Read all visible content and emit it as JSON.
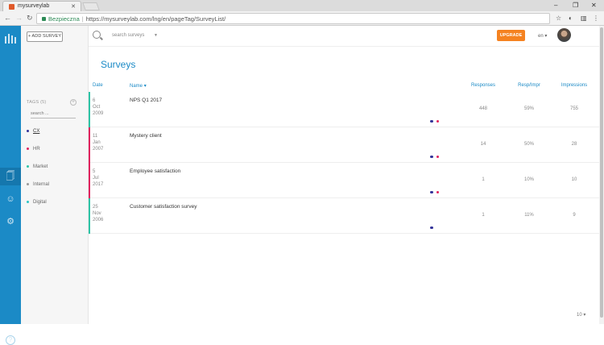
{
  "browser": {
    "tab_title": "mysurveylab",
    "secure_label": "Bezpieczna",
    "url": "https://mysurveylab.com/lng/en/pageTag/SurveyList/"
  },
  "app": {
    "add_survey_label": "+ ADD SURVEY",
    "search_placeholder": "search surveys",
    "upgrade_label": "UPGRADE",
    "language": "en",
    "page_title": "Surveys",
    "tags": {
      "heading": "TAGS (5)",
      "search_placeholder": "search ...",
      "items": [
        {
          "label": "CX",
          "color": "#333399"
        },
        {
          "label": "HR",
          "color": "#e0245e"
        },
        {
          "label": "Market",
          "color": "#2ec4a6"
        },
        {
          "label": "Internal",
          "color": "#999999"
        },
        {
          "label": "Digital",
          "color": "#2ec4c4"
        }
      ]
    },
    "columns": {
      "date": "Date",
      "name": "Name",
      "responses": "Responses",
      "resp_impr": "Resp/Impr",
      "impressions": "Impressions"
    },
    "surveys": [
      {
        "day": "6",
        "month": "Oct",
        "year": "2009",
        "name": "NPS Q1 2017",
        "responses": "448",
        "resp_impr": "59%",
        "impressions": "755",
        "bar_color": "#2ec4a6",
        "tag_colors": [
          "#333399",
          "#e0245e"
        ]
      },
      {
        "day": "11",
        "month": "Jan",
        "year": "2007",
        "name": "Mystery client",
        "responses": "14",
        "resp_impr": "50%",
        "impressions": "28",
        "bar_color": "#e0245e",
        "tag_colors": [
          "#333399",
          "#e0245e"
        ]
      },
      {
        "day": "5",
        "month": "Jul",
        "year": "2017",
        "name": "Employee satisfaction",
        "responses": "1",
        "resp_impr": "10%",
        "impressions": "10",
        "bar_color": "#e0245e",
        "tag_colors": [
          "#333399",
          "#e0245e"
        ]
      },
      {
        "day": "25",
        "month": "Nov",
        "year": "2006",
        "name": "Customer satisfaction survey",
        "responses": "1",
        "resp_impr": "11%",
        "impressions": "9",
        "bar_color": "#2ec4a6",
        "tag_colors": [
          "#333399"
        ]
      }
    ],
    "page_size": "10"
  }
}
